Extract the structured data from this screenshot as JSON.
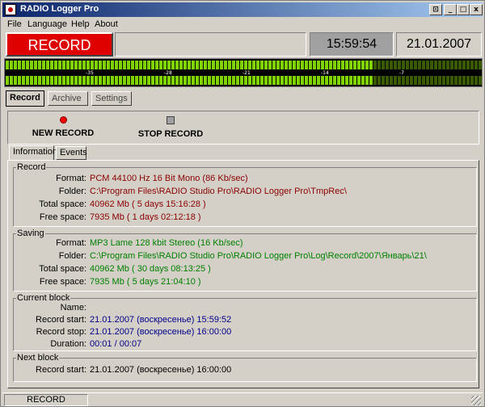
{
  "window": {
    "title": "RADIO Logger Pro",
    "controls": {
      "restore": "⊡",
      "minimize": "_",
      "maximize": "□",
      "close": "x"
    }
  },
  "menu": [
    "File",
    "Language",
    "Help",
    "About"
  ],
  "status": {
    "record_label": "RECORD",
    "time": "15:59:54",
    "date": "21.01.2007"
  },
  "meter": {
    "scale_labels": [
      "-35",
      "-28",
      "-21",
      "-14",
      "-7"
    ],
    "level_fraction": 0.77
  },
  "main_tabs": [
    "Record",
    "Archive",
    "Settings"
  ],
  "actions": {
    "new_record": "NEW RECORD",
    "stop_record": "STOP RECORD"
  },
  "sub_tabs": [
    "Information",
    "Events"
  ],
  "groups": {
    "record": {
      "title": "Record",
      "rows": [
        {
          "label": "Format:",
          "value": "PCM  44100 Hz 16 Bit Mono (86 Kb/sec)"
        },
        {
          "label": "Folder:",
          "value": "C:\\Program Files\\RADIO Studio Pro\\RADIO Logger Pro\\TmpRec\\"
        },
        {
          "label": "Total space:",
          "value": "40962 Mb ( 5 days 15:16:28 )"
        },
        {
          "label": "Free space:",
          "value": "7935 Mb ( 1 days 02:12:18 )"
        }
      ]
    },
    "saving": {
      "title": "Saving",
      "rows": [
        {
          "label": "Format:",
          "value": "MP3  Lame 128 kbit Stereo (16 Kb/sec)"
        },
        {
          "label": "Folder:",
          "value": "C:\\Program Files\\RADIO Studio Pro\\RADIO Logger Pro\\Log\\Record\\2007\\Январь\\21\\"
        },
        {
          "label": "Total space:",
          "value": "40962 Mb ( 30 days 08:13:25 )"
        },
        {
          "label": "Free space:",
          "value": "7935 Mb ( 5 days 21:04:10 )"
        }
      ]
    },
    "current_block": {
      "title": "Current block",
      "rows": [
        {
          "label": "Name:",
          "value": ""
        },
        {
          "label": "Record start:",
          "value": "21.01.2007 (воскресенье) 15:59:52"
        },
        {
          "label": "Record stop:",
          "value": "21.01.2007 (воскресенье) 16:00:00"
        },
        {
          "label": "Duration:",
          "value": "00:01 / 00:07"
        }
      ]
    },
    "next_block": {
      "title": "Next block",
      "rows": [
        {
          "label": "Record start:",
          "value": "21.01.2007 (воскресенье) 16:00:00"
        }
      ]
    }
  },
  "statusbar": {
    "text": "RECORD"
  },
  "colors": {
    "record_bg": "#e00000",
    "meter_on": "#7fd400",
    "meter_off": "#3a5a00",
    "value_red": "#8b0000",
    "value_green": "#008000",
    "value_blue": "#00008b"
  }
}
